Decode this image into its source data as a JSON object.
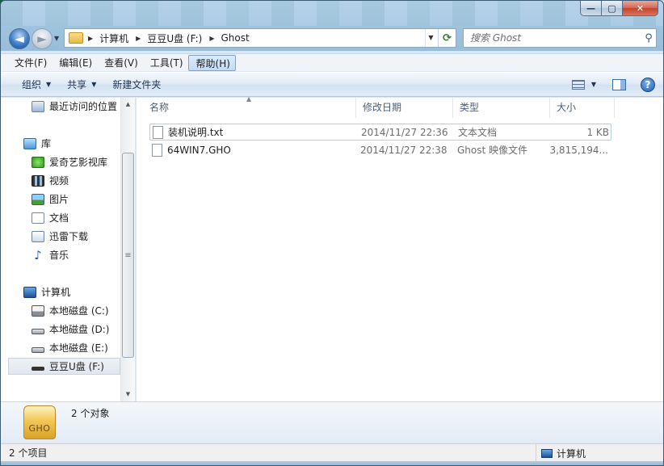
{
  "window": {
    "caption_min": "0",
    "caption_max": "1",
    "caption_close": "r"
  },
  "nav": {
    "back_glyph": "◄",
    "forward_glyph": "►",
    "history_drop": "▼"
  },
  "address": {
    "crumbs": [
      "计算机",
      "豆豆U盘 (F:)",
      "Ghost"
    ],
    "refresh_glyph": "⟳"
  },
  "search": {
    "placeholder": "搜索 Ghost"
  },
  "menu": {
    "items": [
      "文件(F)",
      "编辑(E)",
      "查看(V)",
      "工具(T)",
      "帮助(H)"
    ],
    "active_index": 4
  },
  "toolbar": {
    "organize": "组织",
    "share": "共享",
    "new_folder": "新建文件夹",
    "help": "?"
  },
  "sidebar": {
    "recent": "最近访问的位置",
    "library": "库",
    "library_items": [
      "爱奇艺影视库",
      "视频",
      "图片",
      "文档",
      "迅雷下载",
      "音乐"
    ],
    "computer": "计算机",
    "drives": [
      "本地磁盘 (C:)",
      "本地磁盘 (D:)",
      "本地磁盘 (E:)",
      "豆豆U盘 (F:)"
    ],
    "selected_drive_index": 3
  },
  "columns": {
    "name": "名称",
    "modified": "修改日期",
    "type": "类型",
    "size": "大小"
  },
  "files": [
    {
      "name": "装机说明.txt",
      "modified": "2014/11/27 22:36",
      "type": "文本文档",
      "size": "1 KB"
    },
    {
      "name": "64WIN7.GHO",
      "modified": "2014/11/27 22:38",
      "type": "Ghost 映像文件",
      "size": "3,815,194..."
    }
  ],
  "details": {
    "icon_label": "GHO",
    "count_text": "2 个对象"
  },
  "status": {
    "left": "2 个项目",
    "right": "计算机"
  }
}
